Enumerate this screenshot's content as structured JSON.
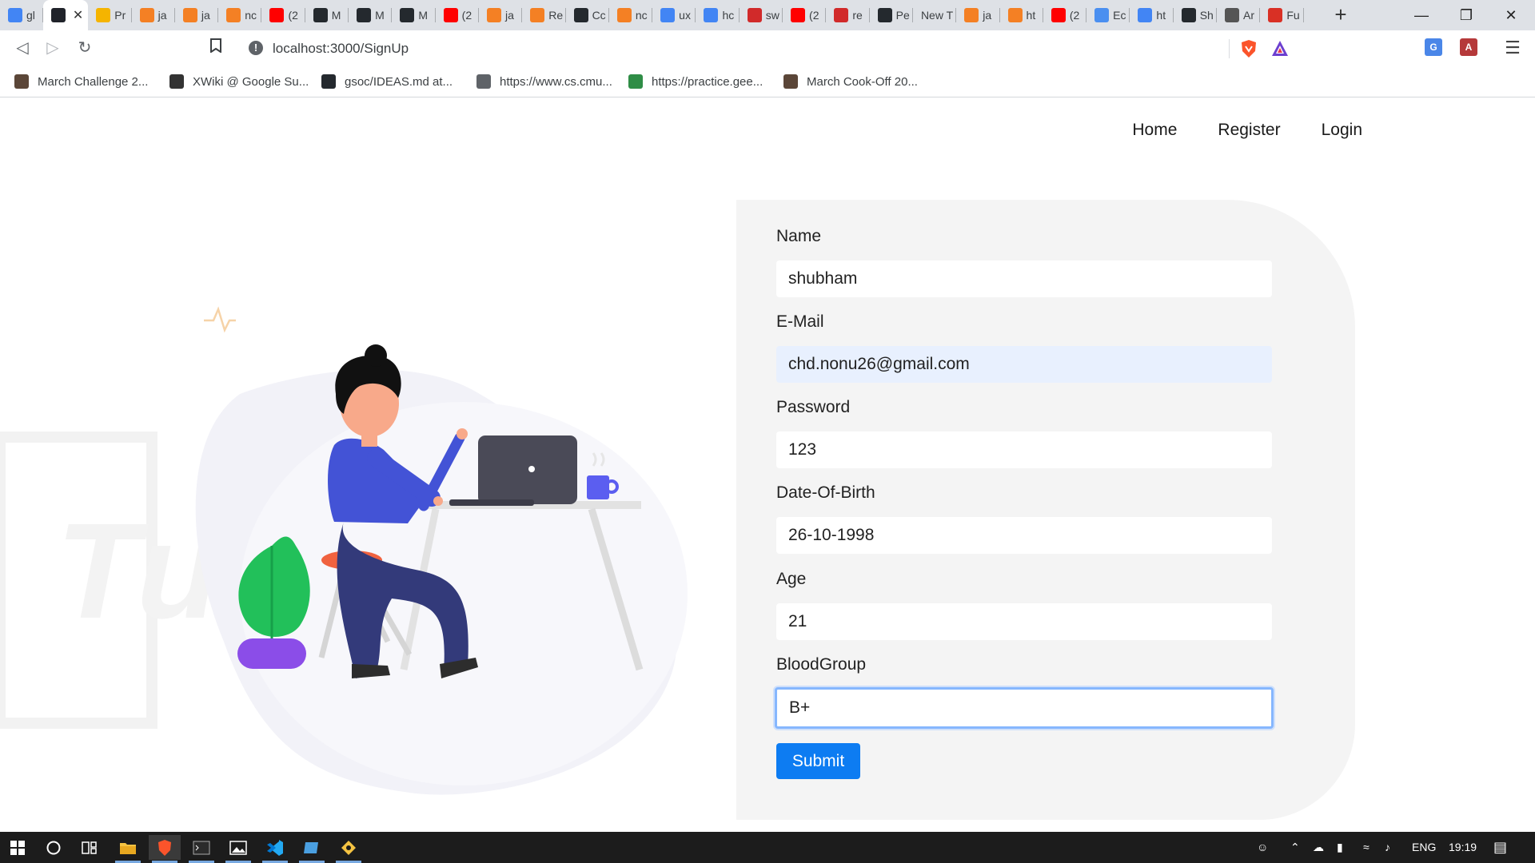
{
  "browser": {
    "tabs": [
      {
        "label": "gl",
        "icon": "google-icon",
        "color": "#4285f4"
      },
      {
        "label": "",
        "icon": "react-icon",
        "color": "#20232a",
        "active": true
      },
      {
        "label": "Pr",
        "icon": "firebase-icon",
        "color": "#f5b400"
      },
      {
        "label": "ja",
        "icon": "stackoverflow-icon",
        "color": "#f48024"
      },
      {
        "label": "ja",
        "icon": "stackoverflow-icon",
        "color": "#f48024"
      },
      {
        "label": "nc",
        "icon": "stackoverflow-icon",
        "color": "#f48024"
      },
      {
        "label": "(2",
        "icon": "youtube-icon",
        "color": "#ff0000"
      },
      {
        "label": "M",
        "icon": "github-icon",
        "color": "#24292e"
      },
      {
        "label": "M",
        "icon": "github-icon",
        "color": "#24292e"
      },
      {
        "label": "M",
        "icon": "github-icon",
        "color": "#24292e"
      },
      {
        "label": "(2",
        "icon": "youtube-icon",
        "color": "#ff0000"
      },
      {
        "label": "ja",
        "icon": "stackoverflow-icon",
        "color": "#f48024"
      },
      {
        "label": "Re",
        "icon": "stackoverflow-icon",
        "color": "#f48024"
      },
      {
        "label": "Cc",
        "icon": "github-icon",
        "color": "#24292e"
      },
      {
        "label": "nc",
        "icon": "stackoverflow-icon",
        "color": "#f48024"
      },
      {
        "label": "ux",
        "icon": "google-icon",
        "color": "#4285f4"
      },
      {
        "label": "hc",
        "icon": "google-icon",
        "color": "#4285f4"
      },
      {
        "label": "sw",
        "icon": "n-logo-icon",
        "color": "#d12a2a"
      },
      {
        "label": "(2",
        "icon": "youtube-icon",
        "color": "#ff0000"
      },
      {
        "label": "re",
        "icon": "n-logo-icon",
        "color": "#d12a2a"
      },
      {
        "label": "Pe",
        "icon": "github-icon",
        "color": "#24292e"
      },
      {
        "label": "New T",
        "icon": "",
        "color": ""
      },
      {
        "label": "ja",
        "icon": "stackoverflow-icon",
        "color": "#f48024"
      },
      {
        "label": "ht",
        "icon": "stackoverflow-icon",
        "color": "#f48024"
      },
      {
        "label": "(2",
        "icon": "youtube-icon",
        "color": "#ff0000"
      },
      {
        "label": "Ec",
        "icon": "cloud-icon",
        "color": "#4a8ff0"
      },
      {
        "label": "ht",
        "icon": "google-icon",
        "color": "#4285f4"
      },
      {
        "label": "Sh",
        "icon": "github-icon",
        "color": "#24292e"
      },
      {
        "label": "Ar",
        "icon": "hand-icon",
        "color": "#555555"
      },
      {
        "label": "Fu",
        "icon": "gmail-icon",
        "color": "#d93025"
      }
    ],
    "new_tab": "+",
    "url": "localhost:3000/SignUp",
    "bookmarks": [
      {
        "label": "March Challenge 2...",
        "icon": "codechef-icon",
        "color": "#5b4638"
      },
      {
        "label": "XWiki @ Google Su...",
        "icon": "xwiki-icon",
        "color": "#333333"
      },
      {
        "label": "gsoc/IDEAS.md at...",
        "icon": "github-icon",
        "color": "#24292e"
      },
      {
        "label": "https://www.cs.cmu...",
        "icon": "globe-icon",
        "color": "#5f6368"
      },
      {
        "label": "https://practice.gee...",
        "icon": "geeksforgeeks-icon",
        "color": "#2f8d46"
      },
      {
        "label": "March Cook-Off 20...",
        "icon": "codechef-icon",
        "color": "#5b4638"
      }
    ]
  },
  "nav": {
    "home": "Home",
    "register": "Register",
    "login": "Login"
  },
  "form": {
    "fields": [
      {
        "label": "Name",
        "value": "shubham"
      },
      {
        "label": "E-Mail",
        "value": "chd.nonu26@gmail.com"
      },
      {
        "label": "Password",
        "value": "123"
      },
      {
        "label": "Date-Of-Birth",
        "value": "26-10-1998"
      },
      {
        "label": "Age",
        "value": "21"
      },
      {
        "label": "BloodGroup",
        "value": "B+"
      }
    ],
    "submit": "Submit"
  },
  "taskbar": {
    "language": "ENG",
    "time": "19:19"
  },
  "colors": {
    "accent": "#0d7cf2",
    "panel": "#f4f4f4",
    "autofill": "#e8f0fe"
  }
}
